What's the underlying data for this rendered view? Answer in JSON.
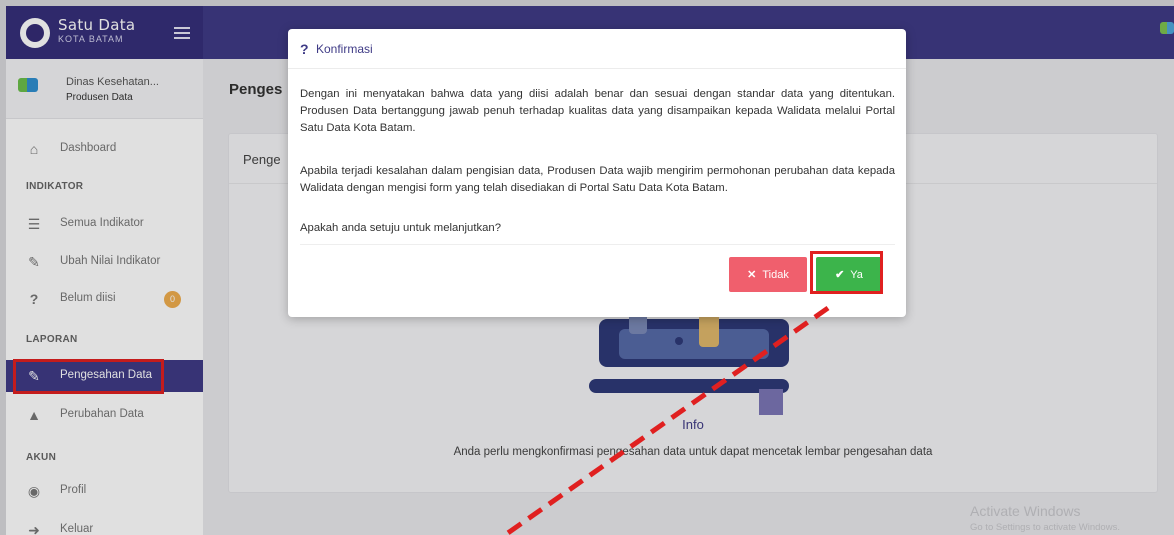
{
  "brand": {
    "title": "Satu Data",
    "subtitle": "KOTA BATAM"
  },
  "user": {
    "name": "Dinas Kesehatan...",
    "role": "Produsen Data"
  },
  "sidebar": {
    "items": [
      {
        "label": "Dashboard",
        "icon": "home-icon"
      },
      {
        "section": "INDIKATOR"
      },
      {
        "label": "Semua Indikator",
        "icon": "list-icon"
      },
      {
        "label": "Ubah Nilai Indikator",
        "icon": "edit-icon"
      },
      {
        "label": "Belum diisi",
        "icon": "question-icon",
        "badge": "0"
      },
      {
        "section": "LAPORAN"
      },
      {
        "label": "Pengesahan Data",
        "icon": "sign-icon",
        "active": true
      },
      {
        "label": "Perubahan Data",
        "icon": "eraser-icon"
      },
      {
        "section": "AKUN"
      },
      {
        "label": "Profil",
        "icon": "user-icon"
      },
      {
        "label": "Keluar",
        "icon": "logout-icon"
      }
    ]
  },
  "main": {
    "heading": "Penges",
    "card_title": "Penge",
    "info_label": "Info",
    "info_text": "Anda perlu mengkonfirmasi pengesahan data untuk dapat mencetak lembar pengesahan data"
  },
  "modal": {
    "icon": "?",
    "title": "Konfirmasi",
    "paragraph1": "Dengan ini menyatakan bahwa data yang diisi adalah benar dan sesuai dengan standar data yang ditentukan. Produsen Data bertanggung jawab penuh terhadap kualitas data yang disampaikan kepada Walidata melalui Portal Satu Data Kota Batam.",
    "paragraph2": "Apabila terjadi kesalahan dalam pengisian data, Produsen Data wajib mengirim permohonan perubahan data kepada Walidata dengan mengisi form yang telah disediakan di Portal Satu Data Kota Batam.",
    "paragraph3": "Apakah anda setuju untuk melanjutkan?",
    "no_label": "Tidak",
    "yes_label": "Ya"
  },
  "watermark": {
    "title": "Activate Windows",
    "subtitle": "Go to Settings to activate Windows."
  },
  "colors": {
    "primary": "#3f3b86",
    "danger": "#f05f6d",
    "success": "#3cb44b",
    "annotation": "#e02020"
  }
}
